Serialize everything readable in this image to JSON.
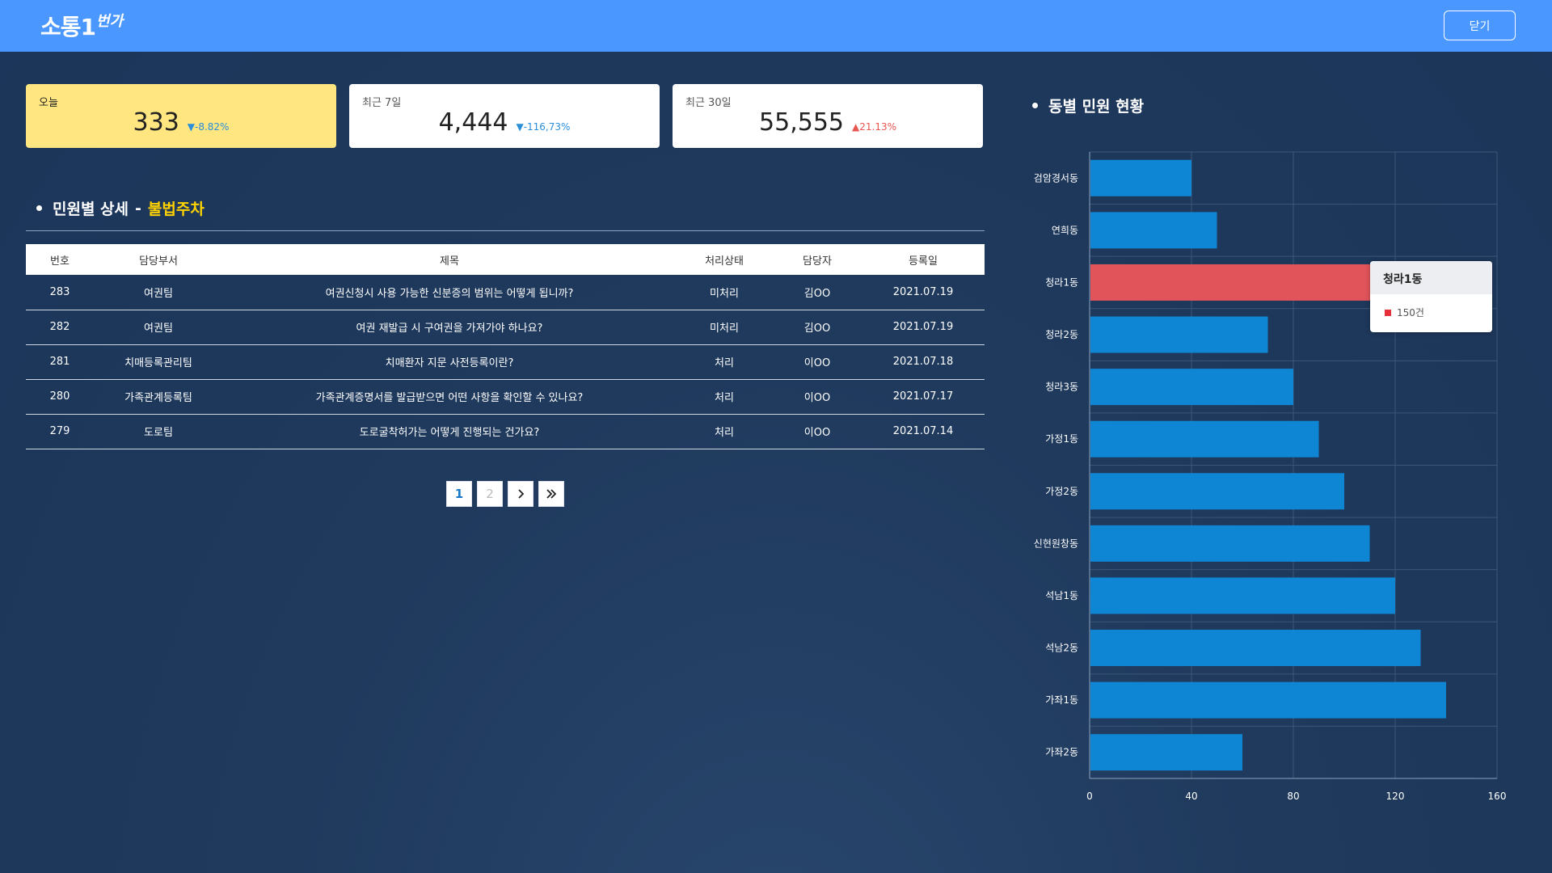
{
  "header": {
    "logo_main": "소통1",
    "logo_sup": "번가",
    "close_label": "닫기"
  },
  "cards": [
    {
      "label": "오늘",
      "value": "333",
      "delta": "▼-8.82%",
      "direction": "down"
    },
    {
      "label": "최근 7일",
      "value": "4,444",
      "delta": "▼-116,73%",
      "direction": "down"
    },
    {
      "label": "최근 30일",
      "value": "55,555",
      "delta": "▲21.13%",
      "direction": "up"
    }
  ],
  "list_section": {
    "title": "민원별 상세",
    "separator": "-",
    "category": "불법주차"
  },
  "table": {
    "headers": [
      "번호",
      "담당부서",
      "제목",
      "처리상태",
      "담당자",
      "등록일"
    ],
    "rows": [
      [
        "283",
        "여권팀",
        "여권신청시 사용 가능한 신분증의 범위는 어떻게 됩니까?",
        "미처리",
        "김OO",
        "2021.07.19"
      ],
      [
        "282",
        "여권팀",
        "여권 재발급 시 구여권을 가져가야 하나요?",
        "미처리",
        "김OO",
        "2021.07.19"
      ],
      [
        "281",
        "치매등록관리팀",
        "치매환자 지문 사전등록이란?",
        "처리",
        "이OO",
        "2021.07.18"
      ],
      [
        "280",
        "가족관계등록팀",
        "가족관계증명서를 발급받으면 어떤 사항을 확인할 수 있나요?",
        "처리",
        "이OO",
        "2021.07.17"
      ],
      [
        "279",
        "도로팀",
        "도로굴착허가는 어떻게 진행되는 건가요?",
        "처리",
        "이OO",
        "2021.07.14"
      ]
    ]
  },
  "pagination": {
    "pages": [
      "1",
      "2"
    ],
    "current": "1"
  },
  "chart_section": {
    "title": "동별 민원 현황"
  },
  "tooltip": {
    "title": "청라1동",
    "value": "150건"
  },
  "colors": {
    "header_bg": "#4a98ff",
    "today_card": "#ffe681",
    "bar": "#0f86d4",
    "bar_highlight": "#e0545a",
    "accent_yellow": "#ffd200"
  },
  "chart_data": {
    "type": "bar",
    "orientation": "horizontal",
    "categories": [
      "검암경서동",
      "연희동",
      "청라1동",
      "청라2동",
      "청라3동",
      "가정1동",
      "가정2동",
      "신현원창동",
      "석남1동",
      "석남2동",
      "가좌1동",
      "가좌2동"
    ],
    "values": [
      40,
      50,
      150,
      70,
      80,
      90,
      100,
      110,
      120,
      130,
      140,
      60
    ],
    "highlight": "청라1동",
    "xlim": [
      0,
      160
    ],
    "xticks": [
      0,
      40,
      80,
      120,
      160
    ],
    "grid": true,
    "title": "",
    "xlabel": "",
    "ylabel": ""
  }
}
